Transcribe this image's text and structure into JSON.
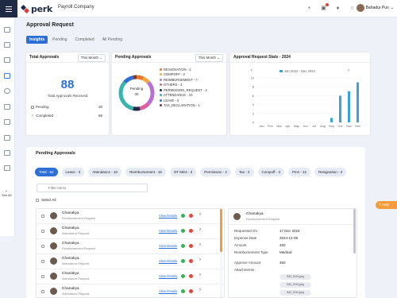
{
  "header": {
    "logo_text": "perk",
    "company": "Payroll Company",
    "user_name": "Bahadur Pun",
    "icons": [
      "plus-icon",
      "gift-icon",
      "bell-icon",
      "headset-icon"
    ]
  },
  "sidebar": {
    "icons": [
      "wallet-icon",
      "calendar-icon",
      "money-icon",
      "clipboard-icon",
      "clock-icon",
      "document-icon",
      "book-icon",
      "id-card-icon",
      "team-icon",
      "chart-icon"
    ],
    "see_all": "See All"
  },
  "page": {
    "title": "Approval Request",
    "tabs": [
      {
        "label": "Insights",
        "active": true
      },
      {
        "label": "Pending",
        "active": false
      },
      {
        "label": "Completed",
        "active": false
      },
      {
        "label": "All Pending",
        "active": false
      }
    ]
  },
  "total_approvals": {
    "title": "Total Approvals",
    "period": "This Month",
    "total": "88",
    "total_label": "Total Approvals Received",
    "pending_label": "Pending",
    "pending_value": "30",
    "completed_label": "Completed",
    "completed_value": "58"
  },
  "pending_approvals_card": {
    "title": "Pending Approvals",
    "period": "This Month",
    "donut_label": "Pending",
    "donut_value": "30",
    "legend": [
      {
        "label": "RESIGNATION - 2",
        "color": "#e8742c",
        "value": 2
      },
      {
        "label": "COMPOFF - 2",
        "color": "#f2a93b",
        "value": 2
      },
      {
        "label": "REIMBURSEMENT - 7",
        "color": "#b96fd6",
        "value": 7
      },
      {
        "label": "OTHERS - 3",
        "color": "#e05ca0",
        "value": 3
      },
      {
        "label": "PERMISSION_REQUEST - 2",
        "color": "#1f2a44",
        "value": 2
      },
      {
        "label": "ATTENDANCE - 10",
        "color": "#3bb4b0",
        "value": 10
      },
      {
        "label": "LEAVE - 3",
        "color": "#2d6fd6",
        "value": 3
      },
      {
        "label": "TAX_DECLARATION - 1",
        "color": "#7a3b2e",
        "value": 1
      }
    ]
  },
  "stats_card": {
    "title": "Approval Request Stats - 2024",
    "legend_label": "Jan 2024 - Dec 2024"
  },
  "chart_data": {
    "type": "bar",
    "title": "Approval Request Stats - 2024",
    "categories": [
      "Jan",
      "Feb",
      "Mar",
      "Apr",
      "May",
      "Jun",
      "Jul",
      "Aug",
      "Sep",
      "Oct",
      "Nov",
      "Dec"
    ],
    "values": [
      0,
      0,
      0,
      0,
      0,
      0,
      0,
      0,
      1,
      6,
      7,
      9
    ],
    "yticks": [
      "10",
      "8",
      "6",
      "4",
      "2",
      "0"
    ],
    "ylim": [
      0,
      10
    ],
    "color": "#3aa3d8"
  },
  "pending_panel": {
    "title": "Pending Approvals",
    "filters": [
      {
        "label": "Total - 52",
        "active": true
      },
      {
        "label": "Leave - 3",
        "active": false
      },
      {
        "label": "Attendance - 10",
        "active": false
      },
      {
        "label": "Reimbursement - 15",
        "active": false
      },
      {
        "label": "OT Mins - 3",
        "active": false
      },
      {
        "label": "Permission - 2",
        "active": false
      },
      {
        "label": "Tax - 2",
        "active": false
      },
      {
        "label": "Compoff - 3",
        "active": false
      },
      {
        "label": "Pms - 12",
        "active": false
      },
      {
        "label": "Resignation - 2",
        "active": false
      }
    ],
    "filter_placeholder": "Filter Items",
    "select_all": "Select All",
    "rows": [
      {
        "name": "Chanakya",
        "type": "Reimbursement Request",
        "view": "View Details"
      },
      {
        "name": "Chanakya",
        "type": "Attendance Request",
        "view": "View Details"
      },
      {
        "name": "Chanakya",
        "type": "Reimbursement Request",
        "view": "View Details"
      },
      {
        "name": "Chanakya",
        "type": "Attendance Request",
        "view": "View Details"
      },
      {
        "name": "Chanakya",
        "type": "Attendance Request",
        "view": "View Details"
      },
      {
        "name": "Chanakya",
        "type": "Attendance Request",
        "view": "View Details"
      }
    ],
    "detail": {
      "name": "Chanakya",
      "type": "Reimbursement Request",
      "fields": [
        {
          "key": "Requested On",
          "value": "17 Dec 2024"
        },
        {
          "key": "Expense Date",
          "value": "2024-12-09"
        },
        {
          "key": "Amount",
          "value": "450"
        },
        {
          "key": "Reimbursement Type",
          "value": "Medical"
        },
        {
          "key": "Approve Amount",
          "value": "450"
        },
        {
          "key": "Attachments :",
          "value": ""
        }
      ],
      "attachments": [
        "IMG_0016.jpeg",
        "IMG_0016.jpeg",
        "IMG_0016.jpeg"
      ]
    }
  },
  "help_label": "Help"
}
